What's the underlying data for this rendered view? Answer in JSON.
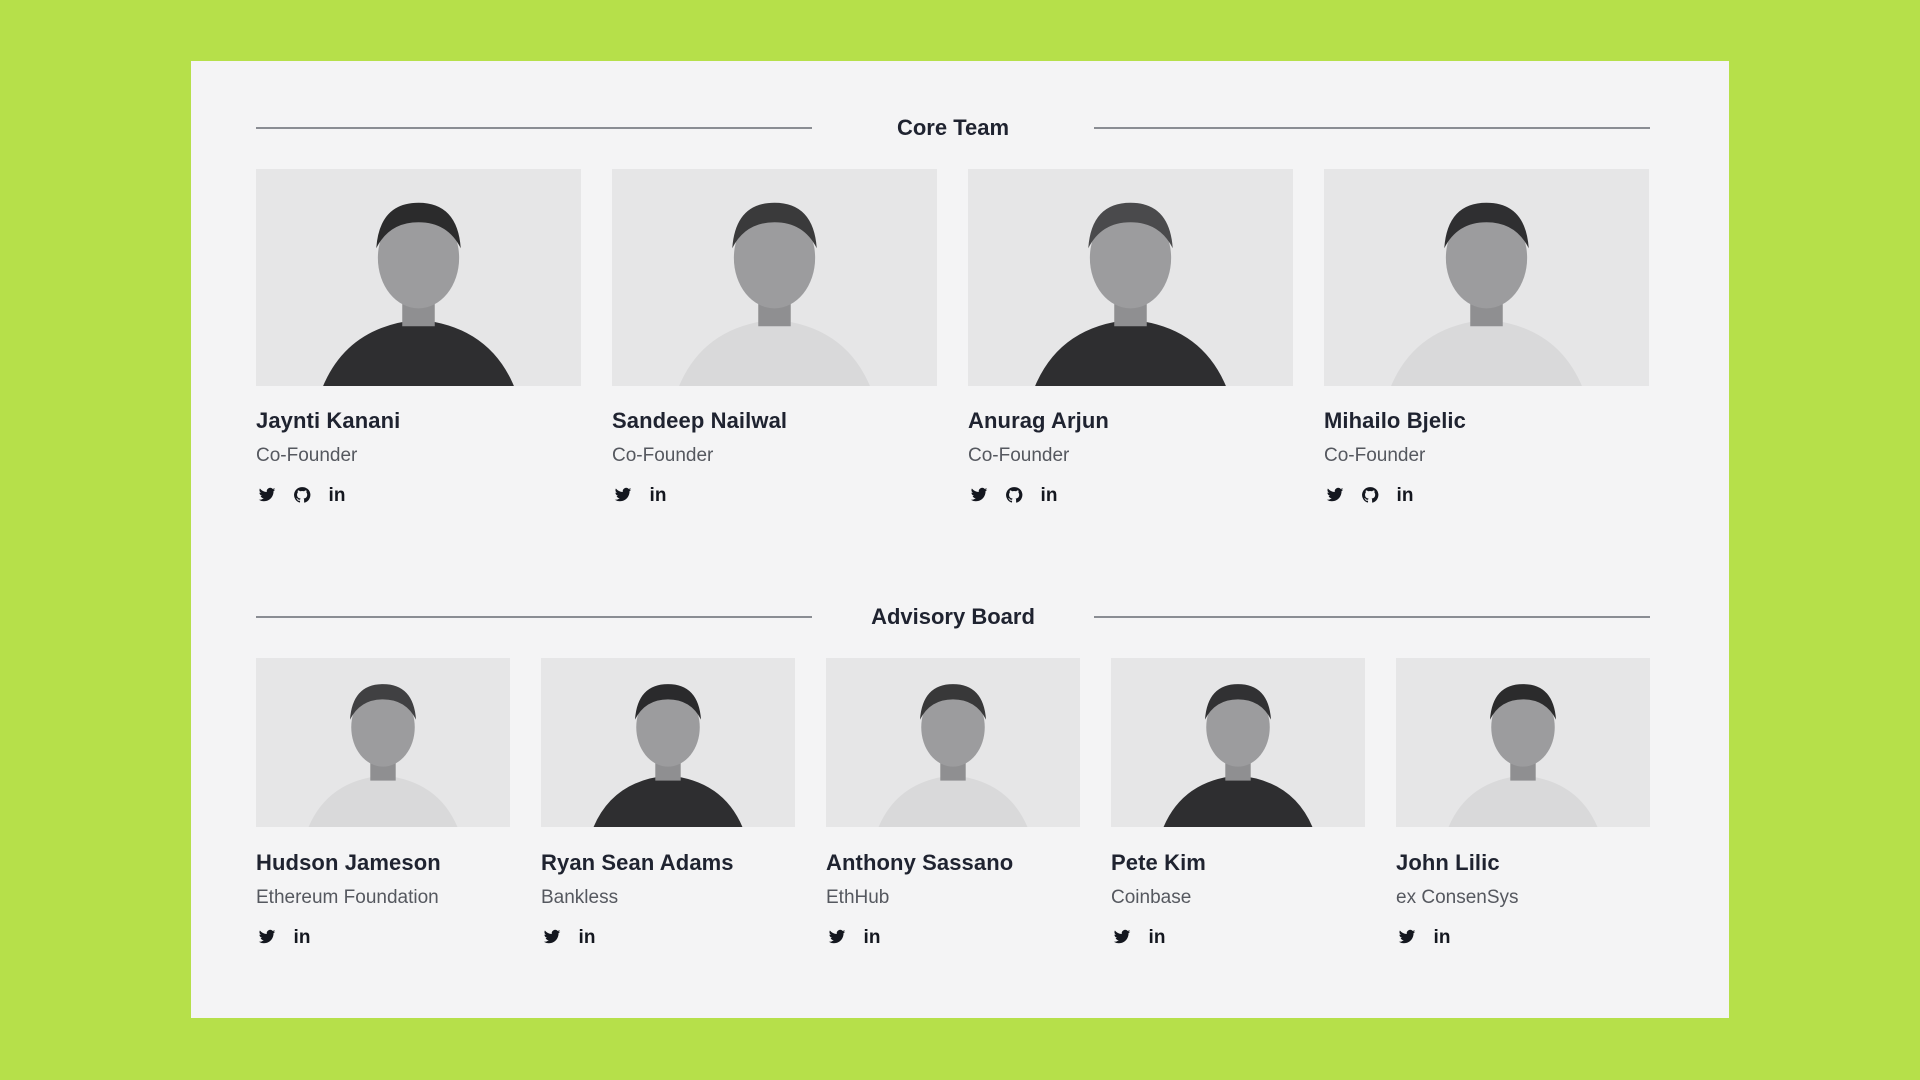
{
  "core_team": {
    "title": "Core Team",
    "members": [
      {
        "name": "Jaynti Kanani",
        "role": "Co-Founder",
        "socials": [
          "twitter-icon",
          "github-icon",
          "linkedin-icon"
        ]
      },
      {
        "name": "Sandeep Nailwal",
        "role": "Co-Founder",
        "socials": [
          "twitter-icon",
          "linkedin-icon"
        ]
      },
      {
        "name": "Anurag Arjun",
        "role": "Co-Founder",
        "socials": [
          "twitter-icon",
          "github-icon",
          "linkedin-icon"
        ]
      },
      {
        "name": "Mihailo Bjelic",
        "role": "Co-Founder",
        "socials": [
          "twitter-icon",
          "github-icon",
          "linkedin-icon"
        ]
      }
    ]
  },
  "advisory_board": {
    "title": "Advisory Board",
    "members": [
      {
        "name": "Hudson Jameson",
        "role": "Ethereum Foundation",
        "socials": [
          "twitter-icon",
          "linkedin-icon"
        ]
      },
      {
        "name": "Ryan Sean Adams",
        "role": "Bankless",
        "socials": [
          "twitter-icon",
          "linkedin-icon"
        ]
      },
      {
        "name": "Anthony Sassano",
        "role": "EthHub",
        "socials": [
          "twitter-icon",
          "linkedin-icon"
        ]
      },
      {
        "name": "Pete Kim",
        "role": "Coinbase",
        "socials": [
          "twitter-icon",
          "linkedin-icon"
        ]
      },
      {
        "name": "John Lilic",
        "role": "ex ConsenSys",
        "socials": [
          "twitter-icon",
          "linkedin-icon"
        ]
      }
    ]
  },
  "linkedin_glyph": "in",
  "colors": {
    "background": "#b6e04a",
    "card": "#f4f4f5",
    "text": "#1f2330",
    "muted": "#55585f"
  }
}
